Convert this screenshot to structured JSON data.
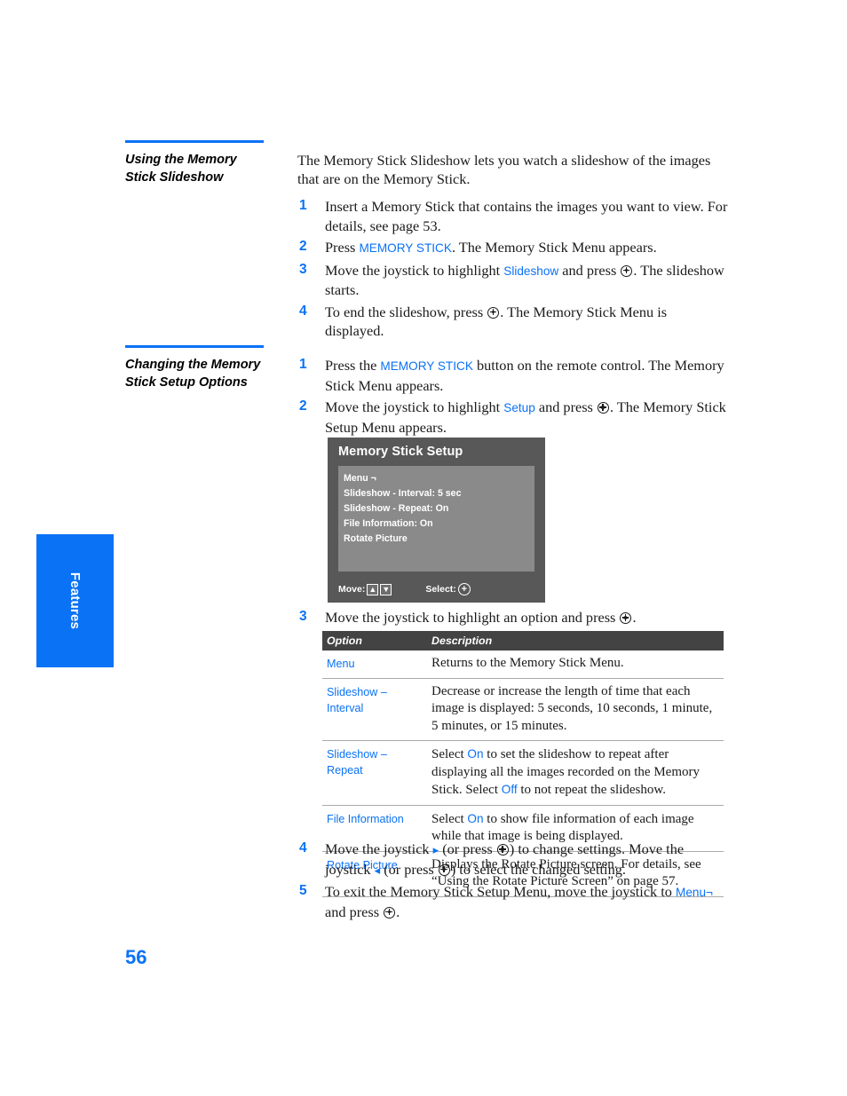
{
  "side_tab": {
    "label": "Features"
  },
  "page_number": "56",
  "sections": [
    {
      "title": "Using the Memory Stick Slideshow",
      "lead": "The Memory Stick Slideshow lets you watch a slideshow of the images that are on the Memory Stick.",
      "steps": [
        {
          "num": "1",
          "parts": [
            {
              "t": "text",
              "v": "Insert a Memory Stick that contains the images you want to view. For details, see page 53."
            }
          ]
        },
        {
          "num": "2",
          "parts": [
            {
              "t": "text",
              "v": "Press "
            },
            {
              "t": "blue",
              "v": "MEMORY STICK"
            },
            {
              "t": "text",
              "v": ". The Memory Stick Menu appears."
            }
          ]
        },
        {
          "num": "3",
          "parts": [
            {
              "t": "text",
              "v": "Move the joystick to highlight "
            },
            {
              "t": "blue",
              "v": "Slideshow"
            },
            {
              "t": "text",
              "v": " and press "
            },
            {
              "t": "icon",
              "v": "joystick-press-icon"
            },
            {
              "t": "text",
              "v": ". The slideshow starts."
            }
          ]
        },
        {
          "num": "4",
          "parts": [
            {
              "t": "text",
              "v": "To end the slideshow, press "
            },
            {
              "t": "icon",
              "v": "joystick-press-icon"
            },
            {
              "t": "text",
              "v": ". The Memory Stick Menu is displayed."
            }
          ]
        }
      ]
    },
    {
      "title": "Changing the Memory Stick Setup Options",
      "steps": [
        {
          "num": "1",
          "parts": [
            {
              "t": "text",
              "v": "Press the "
            },
            {
              "t": "blue",
              "v": "MEMORY STICK"
            },
            {
              "t": "text",
              "v": " button on the remote control. The Memory Stick Menu appears."
            }
          ]
        },
        {
          "num": "2",
          "parts": [
            {
              "t": "text",
              "v": "Move the joystick to highlight "
            },
            {
              "t": "blue",
              "v": "Setup"
            },
            {
              "t": "text",
              "v": " and press "
            },
            {
              "t": "icon",
              "v": "joystick-press-icon"
            },
            {
              "t": "text",
              "v": ". The Memory Stick Setup Menu appears."
            }
          ]
        }
      ],
      "steps_after": [
        {
          "num": "3",
          "parts": [
            {
              "t": "text",
              "v": "Move the joystick to highlight an option and press "
            },
            {
              "t": "icon",
              "v": "joystick-press-icon"
            },
            {
              "t": "text",
              "v": "."
            }
          ]
        }
      ],
      "steps_final": [
        {
          "num": "4",
          "parts": [
            {
              "t": "text",
              "v": "Move the joystick "
            },
            {
              "t": "arrow",
              "v": "▸"
            },
            {
              "t": "text",
              "v": " (or press "
            },
            {
              "t": "icon",
              "v": "joystick-press-icon"
            },
            {
              "t": "text",
              "v": ") to change settings. Move the joystick "
            },
            {
              "t": "arrow",
              "v": "◂"
            },
            {
              "t": "text",
              "v": " (or press "
            },
            {
              "t": "icon",
              "v": "joystick-press-icon"
            },
            {
              "t": "text",
              "v": ") to select the changed setting."
            }
          ]
        },
        {
          "num": "5",
          "parts": [
            {
              "t": "text",
              "v": "To exit the Memory Stick Setup Menu, move the joystick to "
            },
            {
              "t": "blue",
              "v": "Menu¬"
            },
            {
              "t": "text",
              "v": " and press "
            },
            {
              "t": "icon",
              "v": "joystick-press-icon"
            },
            {
              "t": "text",
              "v": "."
            }
          ]
        }
      ]
    }
  ],
  "osd": {
    "title": "Memory Stick Setup",
    "items": [
      "Menu ¬",
      "Slideshow - Interval: 5 sec",
      "Slideshow - Repeat: On",
      "File Information: On",
      "Rotate Picture"
    ],
    "footer": {
      "move_label": "Move:",
      "move_up_key": "⬆",
      "move_down_key": "⬇",
      "select_label": "Select:",
      "select_key": "+"
    }
  },
  "options_table": {
    "headers": {
      "option": "Option",
      "description": "Description"
    },
    "rows": [
      {
        "option": "Menu",
        "desc_parts": [
          {
            "t": "text",
            "v": "Returns to the Memory Stick Menu."
          }
        ]
      },
      {
        "option": "Slideshow – Interval",
        "desc_parts": [
          {
            "t": "text",
            "v": "Decrease or increase the length of time that each image is displayed: 5 seconds, 10 seconds, 1 minute, 5 minutes, or 15 minutes."
          }
        ]
      },
      {
        "option": "Slideshow – Repeat",
        "desc_parts": [
          {
            "t": "text",
            "v": "Select "
          },
          {
            "t": "blue",
            "v": "On"
          },
          {
            "t": "text",
            "v": " to set the slideshow to repeat after displaying all the images recorded on the Memory Stick. Select "
          },
          {
            "t": "blue",
            "v": "Off"
          },
          {
            "t": "text",
            "v": " to not repeat the slideshow."
          }
        ]
      },
      {
        "option": "File Information",
        "desc_parts": [
          {
            "t": "text",
            "v": "Select "
          },
          {
            "t": "blue",
            "v": "On"
          },
          {
            "t": "text",
            "v": " to show file information of each image while that image is being displayed."
          }
        ]
      },
      {
        "option": "Rotate Picture",
        "desc_parts": [
          {
            "t": "text",
            "v": "Displays the Rotate Picture screen. For details, see “Using the Rotate Picture Screen” on page 57."
          }
        ]
      }
    ]
  },
  "colors": {
    "accent": "#0a72f5",
    "table_header_bg": "#434343",
    "osd_bg": "#585858",
    "osd_panel": "#8a8a8a"
  }
}
